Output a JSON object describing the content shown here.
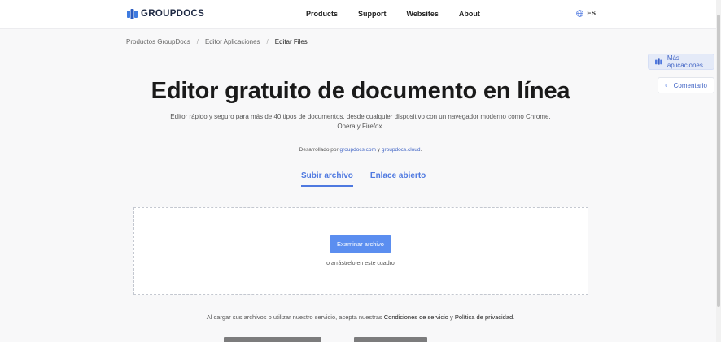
{
  "header": {
    "logo_text": "GROUPDOCS",
    "nav": [
      "Products",
      "Support",
      "Websites",
      "About"
    ],
    "lang": "ES"
  },
  "breadcrumb": {
    "items": [
      "Productos GroupDocs",
      "Editor Aplicaciones",
      "Editar Files"
    ],
    "separator": "/"
  },
  "side": {
    "apps_label": "Más aplicaciones",
    "comment_label": "Comentario"
  },
  "main": {
    "title": "Editor gratuito de documento en línea",
    "subtitle": "Editor rápido y seguro para más de 40 tipos de documentos, desde cualquier dispositivo con un navegador moderno como Chrome, Opera y Firefox.",
    "powered_prefix": "Desarrollado por ",
    "powered_link1": "groupdocs.com",
    "powered_and": " y ",
    "powered_link2": "groupdocs.cloud",
    "powered_suffix": "."
  },
  "tabs": {
    "upload": "Subir archivo",
    "open_link": "Enlace abierto"
  },
  "upload": {
    "browse_label": "Examinar archivo",
    "drag_hint": "o arrástrelo en este cuadro"
  },
  "terms": {
    "prefix": "Al cargar sus archivos o utilizar nuestro servicio, acepta nuestras ",
    "tos": "Condiciones de servicio",
    "and": " y ",
    "privacy": "Política de privacidad",
    "suffix": "."
  },
  "colors": {
    "accent": "#4f79e0",
    "button": "#5b8ef0",
    "brand": "#1f2a44"
  }
}
